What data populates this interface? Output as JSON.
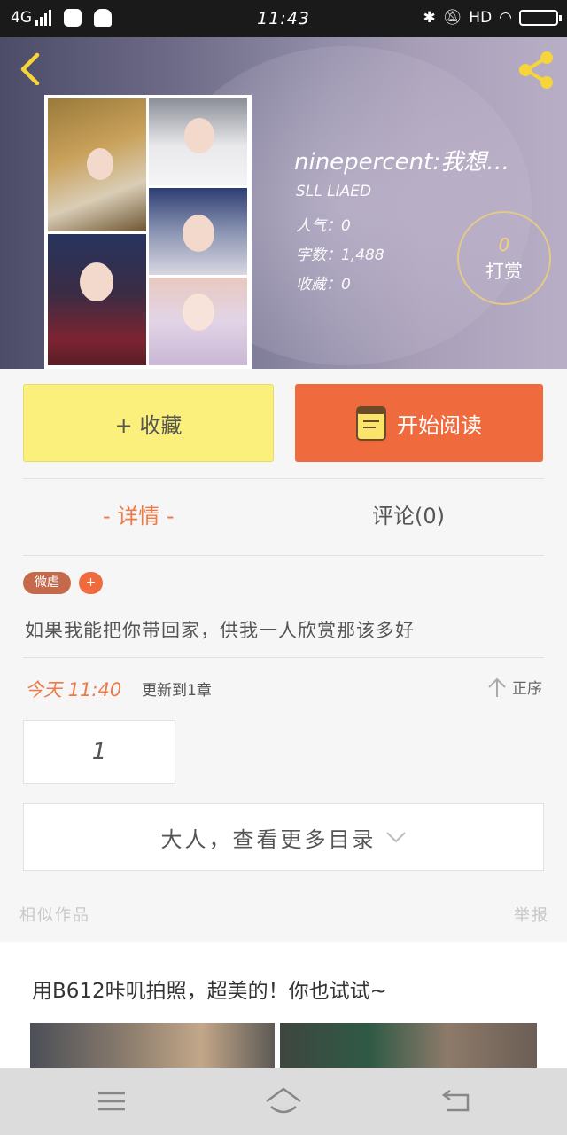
{
  "status_bar": {
    "network": "4G",
    "time": "11:43",
    "hd": "HD"
  },
  "header": {
    "title": "ninepercent:我想…",
    "author": "SLL LIAED",
    "popularity": "人气：0",
    "word_count": "字数：1,488",
    "favorites": "收藏：0",
    "tip_count": "0",
    "tip_label": "打赏"
  },
  "actions": {
    "collect_label": "+ 收藏",
    "read_label": "开始阅读"
  },
  "tabs": {
    "detail": "- 详情 -",
    "comments": "评论(0)"
  },
  "tags": {
    "items": [
      "微虐"
    ],
    "add": "+"
  },
  "description": "如果我能把你带回家，供我一人欣赏那该多好",
  "update": {
    "time": "今天 11:40",
    "text": "更新到1章",
    "order_label": "正序"
  },
  "chapters": {
    "items": [
      "1"
    ],
    "more_label": "大人，查看更多目录"
  },
  "footer": {
    "similar_label": "相似作品",
    "report_label": "举报"
  },
  "ad": {
    "text": "用B612咔叽拍照，超美的！你也试试~"
  },
  "colors": {
    "accent_orange": "#ef6b3d",
    "collect_yellow": "#fbf07b",
    "tip_gold": "#e3c98a",
    "back_yellow": "#f5d53a"
  },
  "icons": {
    "back": "back-chevron-icon",
    "share": "share-icon",
    "book": "book-icon",
    "order": "arrow-up-icon",
    "expand": "chevron-down-icon",
    "menu": "menu-icon",
    "home": "home-icon",
    "return": "return-icon"
  }
}
